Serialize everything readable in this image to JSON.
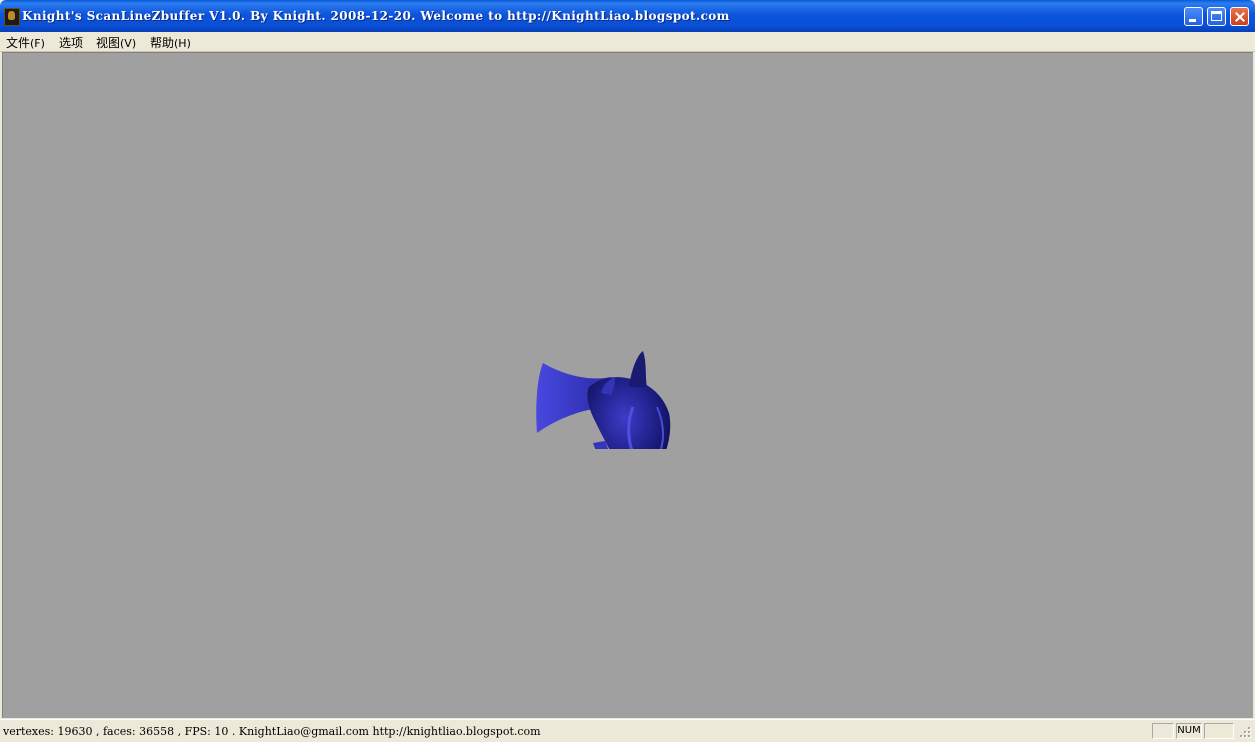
{
  "window": {
    "title": "Knight's ScanLineZbuffer V1.0. By Knight. 2008-12-20.  Welcome to http://KnightLiao.blogspot.com"
  },
  "menu": {
    "items": [
      {
        "label": "文件",
        "accel": "(F)"
      },
      {
        "label": "选项",
        "accel": ""
      },
      {
        "label": "视图",
        "accel": "(V)"
      },
      {
        "label": "帮助",
        "accel": "(H)"
      }
    ]
  },
  "viewport": {
    "background_color": "#a0a0a0",
    "model_color": "#2f2fb5",
    "model_icon": "fish-model"
  },
  "status": {
    "text": "vertexes: 19630 , faces: 36558 , FPS: 10 .   KnightLiao@gmail.com   http://knightliao.blogspot.com",
    "indicator_num": "NUM"
  },
  "colors": {
    "titlebar": "#0a4fd6",
    "close_button": "#c8401c",
    "chrome": "#ece9d8"
  }
}
